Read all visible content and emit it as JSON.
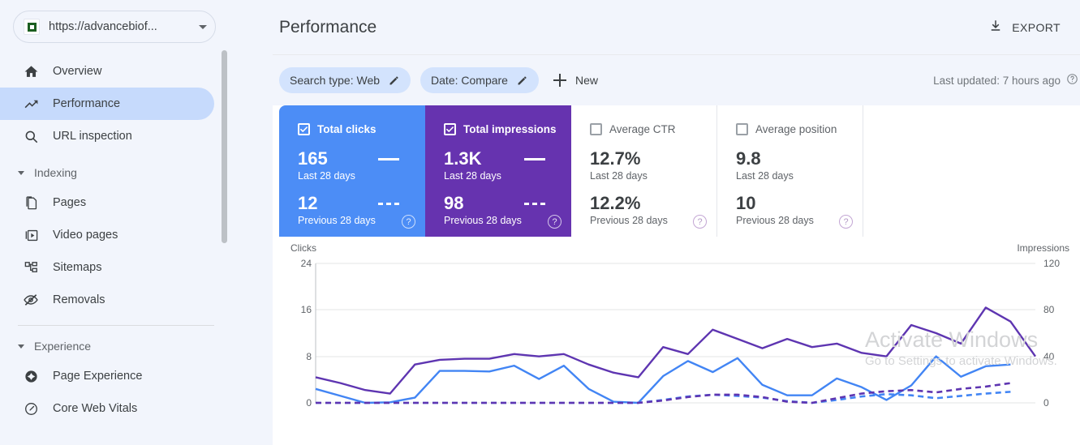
{
  "sidebar": {
    "property": {
      "url": "https://advancebiof...",
      "favicon_icon": "site-favicon",
      "dropdown_icon": "chevron-down-icon"
    },
    "items": [
      {
        "label": "Overview",
        "icon": "home-icon",
        "active": false
      },
      {
        "label": "Performance",
        "icon": "trending-up-icon",
        "active": true
      },
      {
        "label": "URL inspection",
        "icon": "search-icon",
        "active": false
      }
    ],
    "groups": [
      {
        "label": "Indexing",
        "items": [
          {
            "label": "Pages",
            "icon": "pages-icon"
          },
          {
            "label": "Video pages",
            "icon": "video-pages-icon"
          },
          {
            "label": "Sitemaps",
            "icon": "sitemaps-icon"
          },
          {
            "label": "Removals",
            "icon": "eye-off-icon"
          }
        ]
      },
      {
        "label": "Experience",
        "items": [
          {
            "label": "Page Experience",
            "icon": "page-experience-icon"
          },
          {
            "label": "Core Web Vitals",
            "icon": "gauge-icon"
          }
        ]
      }
    ]
  },
  "header": {
    "title": "Performance",
    "export_label": "EXPORT",
    "export_icon": "download-icon"
  },
  "filters": {
    "chips": [
      {
        "label": "Search type: Web",
        "edit_icon": "pencil-icon"
      },
      {
        "label": "Date: Compare",
        "edit_icon": "pencil-icon"
      }
    ],
    "new_label": "New",
    "new_icon": "plus-icon",
    "last_updated": "Last updated: 7 hours ago",
    "help_icon": "help-circle-icon"
  },
  "metric_cards": [
    {
      "title": "Total clicks",
      "checked": true,
      "style": "filled-blue",
      "color": "#4c8df6",
      "current_value": "165",
      "current_label": "Last 28 days",
      "previous_value": "12",
      "previous_label": "Previous 28 days",
      "help_icon": "help-circle-icon"
    },
    {
      "title": "Total impressions",
      "checked": true,
      "style": "filled-purple",
      "color": "#6633af",
      "current_value": "1.3K",
      "current_label": "Last 28 days",
      "previous_value": "98",
      "previous_label": "Previous 28 days",
      "help_icon": "help-circle-icon"
    },
    {
      "title": "Average CTR",
      "checked": false,
      "style": "plain",
      "color": "#ffffff",
      "current_value": "12.7%",
      "current_label": "Last 28 days",
      "previous_value": "12.2%",
      "previous_label": "Previous 28 days",
      "help_icon": "help-circle-icon"
    },
    {
      "title": "Average position",
      "checked": false,
      "style": "plain",
      "color": "#ffffff",
      "current_value": "9.8",
      "current_label": "Last 28 days",
      "previous_value": "10",
      "previous_label": "Previous 28 days",
      "help_icon": "help-circle-icon"
    }
  ],
  "chart_data": {
    "type": "line",
    "title": "",
    "left_axis_label": "Clicks",
    "right_axis_label": "Impressions",
    "left_ticks": [
      "24",
      "16",
      "8",
      "0"
    ],
    "right_ticks": [
      "120",
      "80",
      "40",
      "0"
    ],
    "ylim_left": [
      0,
      24
    ],
    "ylim_right": [
      0,
      120
    ],
    "grid": true,
    "legend_position": "cards-above",
    "x": [
      1,
      2,
      3,
      4,
      5,
      6,
      7,
      8,
      9,
      10,
      11,
      12,
      13,
      14,
      15,
      16,
      17,
      18,
      19,
      20,
      21,
      22,
      23,
      24,
      25,
      26,
      27,
      28
    ],
    "series": [
      {
        "name": "Clicks (Last 28 days)",
        "axis": "left",
        "color": "#4285f4",
        "style": "solid",
        "values": [
          2.4,
          1.2,
          0,
          0.1,
          0.9,
          5.5,
          5.5,
          5.4,
          6.4,
          4.1,
          6.4,
          2.4,
          0.2,
          0,
          4.6,
          7.2,
          5.3,
          7.7,
          3.1,
          1.3,
          1.3,
          4.2,
          2.7,
          0.5,
          3.0,
          8.0,
          4.5,
          6.3,
          6.6
        ]
      },
      {
        "name": "Impressions (Last 28 days)",
        "axis": "right",
        "color": "#5e35b1",
        "style": "solid",
        "values": [
          22,
          17,
          11,
          8,
          33,
          37,
          38,
          38,
          42,
          40,
          42,
          33,
          26,
          22,
          48,
          42,
          63,
          55,
          47,
          55,
          48,
          51,
          43,
          40,
          67,
          60,
          51,
          82,
          70,
          40
        ]
      },
      {
        "name": "Clicks (Previous 28 days)",
        "axis": "left",
        "color": "#4285f4",
        "style": "dashed",
        "values": [
          0,
          0,
          0,
          0,
          0,
          0,
          0,
          0,
          0,
          0,
          0,
          0,
          0,
          0,
          0.5,
          1.1,
          1.4,
          1.2,
          0.9,
          0.3,
          0,
          0.5,
          1.1,
          1.5,
          1.3,
          0.8,
          1.2,
          1.6,
          1.9
        ]
      },
      {
        "name": "Impressions (Previous 28 days)",
        "axis": "right",
        "color": "#5e35b1",
        "style": "dashed",
        "values": [
          0,
          0,
          0,
          0,
          0,
          0,
          0,
          0,
          0,
          0,
          0,
          0,
          0,
          0,
          2,
          5,
          7,
          7,
          5,
          1,
          0,
          4,
          8,
          10,
          11,
          9,
          12,
          14,
          17
        ]
      }
    ]
  },
  "watermark": {
    "line1": "Activate Windows",
    "line2": "Go to Settings to activate Windows."
  }
}
